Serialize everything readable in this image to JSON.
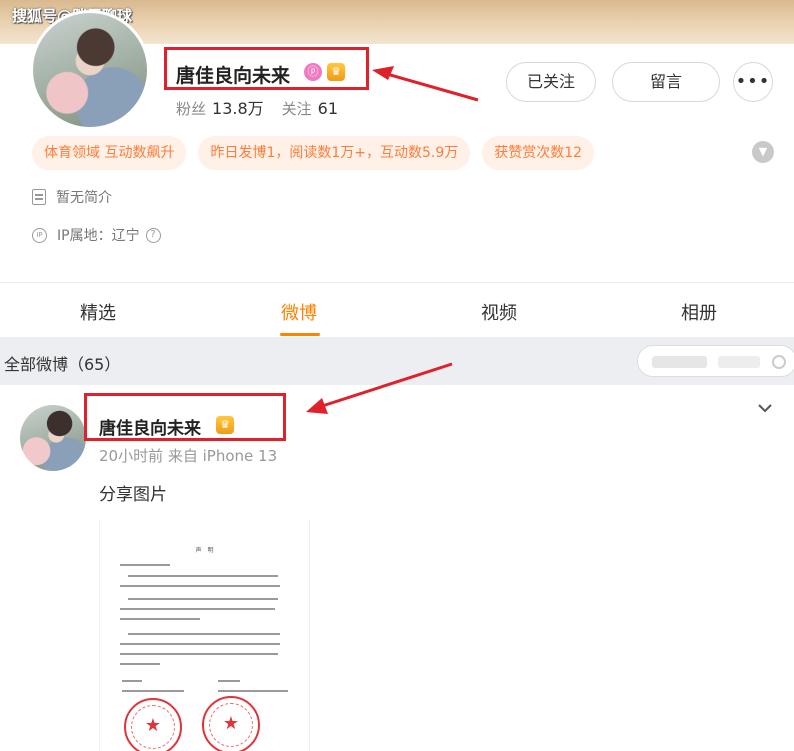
{
  "watermark": "搜狐号@胖周聊球",
  "profile": {
    "name": "唐佳良向未来",
    "badge_glyph": "ⓟ",
    "fans_label": "粉丝",
    "fans_value": "13.8万",
    "following_label": "关注",
    "following_value": "61",
    "btn_follow": "已关注",
    "btn_message": "留言",
    "btn_more": "•••",
    "tags": [
      "体育领域 互动数飙升",
      "昨日发博1，阅读数1万+，互动数5.9万",
      "获赞赏次数12"
    ],
    "bio": "暂无简介",
    "ip": "IP属地：辽宁"
  },
  "tabs": [
    "精选",
    "微博",
    "视频",
    "相册"
  ],
  "active_tab": "微博",
  "filter": {
    "label": "全部微博（65）"
  },
  "post": {
    "name": "唐佳良向未来",
    "meta": "20小时前  来自 iPhone 13",
    "text": "分享图片",
    "doc_title": "声 明"
  },
  "colors": {
    "accent": "#ff8200",
    "annotation": "#e0202a",
    "tag_bg": "#fff0e8",
    "tag_text": "#ff7d3a",
    "seal": "#e0343a"
  },
  "icons": {
    "crown": "crown-badge-icon",
    "bio": "document-icon",
    "ip": "ip-icon",
    "help": "question-icon",
    "expand": "chevron-down-icon",
    "annotation": "red-arrow-icon"
  }
}
